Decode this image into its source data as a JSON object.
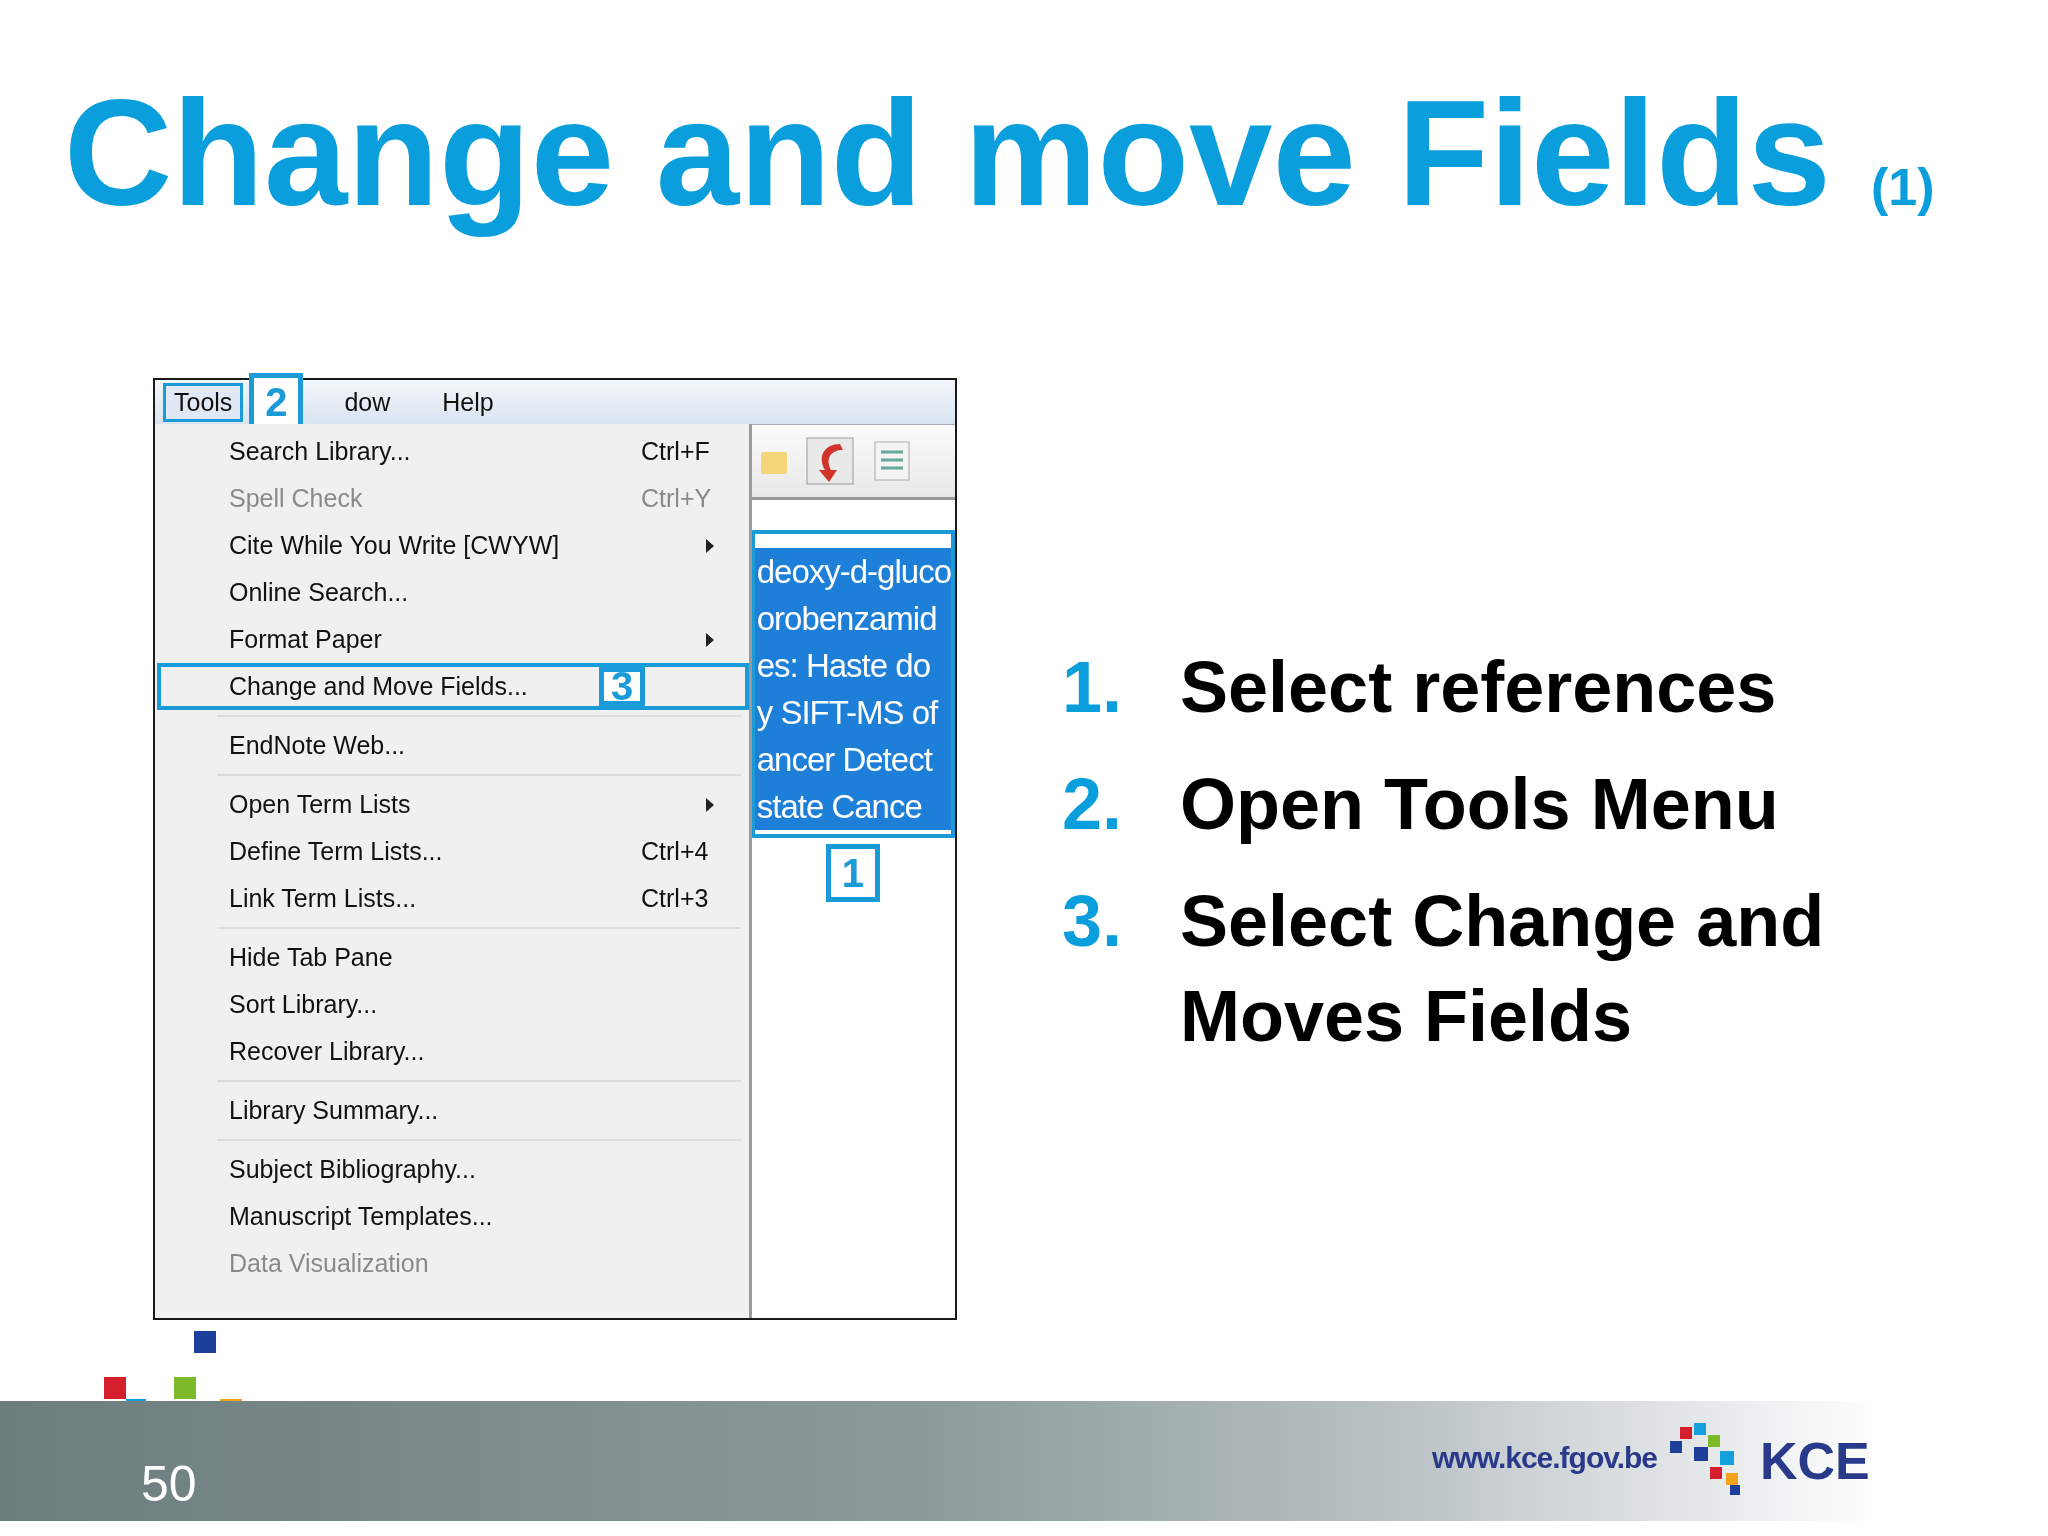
{
  "title": {
    "text": "Change and move Fields",
    "suffix": "(1)"
  },
  "screenshot": {
    "menubar": [
      {
        "label": "Tools",
        "selected": true,
        "marker": "2"
      },
      {
        "label": "dow",
        "selected": false
      },
      {
        "label": "Help",
        "selected": false
      }
    ],
    "menu": [
      {
        "kind": "item",
        "label": "Search Library...",
        "shortcut": "Ctrl+F",
        "disabled": false,
        "submenu": false,
        "outlined": false
      },
      {
        "kind": "item",
        "label": "Spell Check",
        "shortcut": "Ctrl+Y",
        "disabled": true,
        "submenu": false,
        "outlined": false
      },
      {
        "kind": "item",
        "label": "Cite While You Write [CWYW]",
        "disabled": false,
        "submenu": true,
        "outlined": false
      },
      {
        "kind": "item",
        "label": "Online Search...",
        "disabled": false,
        "submenu": false,
        "outlined": false
      },
      {
        "kind": "item",
        "label": "Format Paper",
        "disabled": false,
        "submenu": true,
        "outlined": false
      },
      {
        "kind": "item",
        "label": "Change and Move Fields...",
        "disabled": false,
        "submenu": false,
        "outlined": true,
        "marker": "3"
      },
      {
        "kind": "separator"
      },
      {
        "kind": "item",
        "label": "EndNote Web...",
        "disabled": false,
        "submenu": false,
        "outlined": false
      },
      {
        "kind": "separator"
      },
      {
        "kind": "item",
        "label": "Open Term Lists",
        "disabled": false,
        "submenu": true,
        "outlined": false
      },
      {
        "kind": "item",
        "label": "Define Term Lists...",
        "shortcut": "Ctrl+4",
        "disabled": false,
        "submenu": false,
        "outlined": false
      },
      {
        "kind": "item",
        "label": "Link Term Lists...",
        "shortcut": "Ctrl+3",
        "disabled": false,
        "submenu": false,
        "outlined": false
      },
      {
        "kind": "separator"
      },
      {
        "kind": "item",
        "label": "Hide Tab Pane",
        "disabled": false,
        "submenu": false,
        "outlined": false
      },
      {
        "kind": "item",
        "label": "Sort Library...",
        "disabled": false,
        "submenu": false,
        "outlined": false
      },
      {
        "kind": "item",
        "label": "Recover Library...",
        "disabled": false,
        "submenu": false,
        "outlined": false
      },
      {
        "kind": "separator"
      },
      {
        "kind": "item",
        "label": "Library Summary...",
        "disabled": false,
        "submenu": false,
        "outlined": false
      },
      {
        "kind": "separator"
      },
      {
        "kind": "item",
        "label": "Subject Bibliography...",
        "disabled": false,
        "submenu": false,
        "outlined": false
      },
      {
        "kind": "item",
        "label": "Manuscript Templates...",
        "disabled": false,
        "submenu": false,
        "outlined": false
      },
      {
        "kind": "item",
        "label": "Data Visualization",
        "disabled": true,
        "submenu": false,
        "outlined": false
      }
    ],
    "references": {
      "marker": "1",
      "rows": [
        {
          "text": "deoxy-d-gluco",
          "selected": true
        },
        {
          "text": "orobenzamid",
          "selected": true
        },
        {
          "text": "es: Haste do",
          "selected": true
        },
        {
          "text": "y SIFT-MS of",
          "selected": true
        },
        {
          "text": "ancer Detect",
          "selected": true
        },
        {
          "text": "state Cance",
          "selected": true
        }
      ]
    }
  },
  "steps": [
    {
      "number": "1.",
      "text": "Select references"
    },
    {
      "number": "2.",
      "text": "Open Tools Menu"
    },
    {
      "number": "3.",
      "text": "Select Change and Moves Fields"
    }
  ],
  "footer": {
    "page": "50",
    "url": "www.kce.fgov.be",
    "logo": "KCE"
  }
}
